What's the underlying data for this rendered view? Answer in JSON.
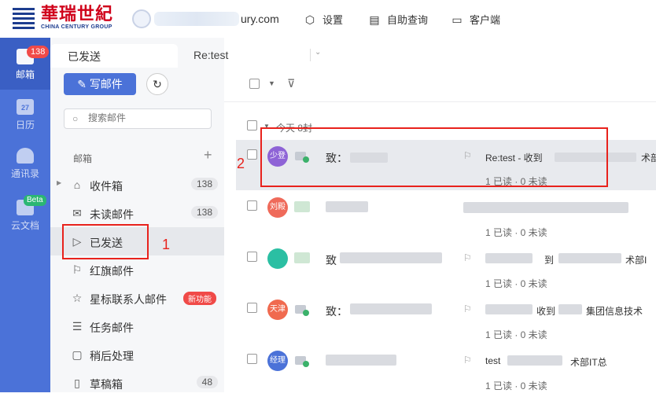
{
  "header": {
    "logo_cn": "華瑞世紀",
    "logo_en": "CHINA CENTURY GROUP",
    "account_suffix": "ury.com",
    "nav": [
      {
        "label": "设置",
        "icon": "settings-icon"
      },
      {
        "label": "自助查询",
        "icon": "self-service-query-icon"
      },
      {
        "label": "客户端",
        "icon": "client-monitor-icon"
      }
    ]
  },
  "leftnav": {
    "items": [
      {
        "label": "邮箱",
        "icon": "mail-icon",
        "badge": "138"
      },
      {
        "label": "日历",
        "icon": "calendar-icon",
        "day": "27"
      },
      {
        "label": "通讯录",
        "icon": "contacts-icon"
      },
      {
        "label": "云文档",
        "icon": "cloud-doc-icon",
        "badge": "Beta"
      }
    ]
  },
  "tabs": [
    {
      "label": "已发送"
    },
    {
      "label": "Re:test"
    }
  ],
  "sidebar": {
    "compose_label": "写邮件",
    "search_placeholder": "搜索邮件",
    "section_label": "邮箱",
    "folders": [
      {
        "label": "收件箱",
        "count": "138",
        "icon": "inbox-icon"
      },
      {
        "label": "未读邮件",
        "count": "138",
        "icon": "unread-mail-icon"
      },
      {
        "label": "已发送",
        "count": "",
        "icon": "sent-icon"
      },
      {
        "label": "红旗邮件",
        "count": "",
        "icon": "flag-icon"
      },
      {
        "label": "星标联系人邮件",
        "count": "",
        "icon": "star-icon",
        "tag": "新功能"
      },
      {
        "label": "任务邮件",
        "count": "",
        "icon": "task-list-icon"
      },
      {
        "label": "稍后处理",
        "count": "",
        "icon": "later-icon"
      },
      {
        "label": "草稿箱",
        "count": "48",
        "icon": "draft-icon"
      }
    ]
  },
  "annotations": {
    "label_1": "1",
    "label_2": "2"
  },
  "maillist": {
    "group_header": "今天 8封",
    "rows": [
      {
        "avatar_text": "少登",
        "avatar_color": "#8e63d6",
        "to_prefix": "致：",
        "subject": "Re:test - 收到",
        "subject_tail": "术部",
        "read_status": "1 已读 · 0 未读"
      },
      {
        "avatar_text": "刘殿",
        "avatar_color": "#ef6a5a",
        "to_prefix": "",
        "subject": "",
        "subject_tail": "",
        "read_status": "1 已读 · 0 未读"
      },
      {
        "avatar_text": "",
        "avatar_color": "#2bbfa3",
        "to_prefix": "致",
        "subject": "到",
        "subject_tail": "术部I",
        "read_status": "1 已读 · 0 未读"
      },
      {
        "avatar_text": "天津",
        "avatar_color": "#f06a4f",
        "to_prefix": "致：",
        "subject": "收到",
        "subject_tail": "集团信息技术",
        "read_status": "1 已读 · 0 未读"
      },
      {
        "avatar_text": "经理",
        "avatar_color": "#4b72d8",
        "to_prefix": "",
        "subject": "test",
        "subject_tail": "术部IT总",
        "read_status": "1 已读 · 0 未读"
      }
    ]
  }
}
